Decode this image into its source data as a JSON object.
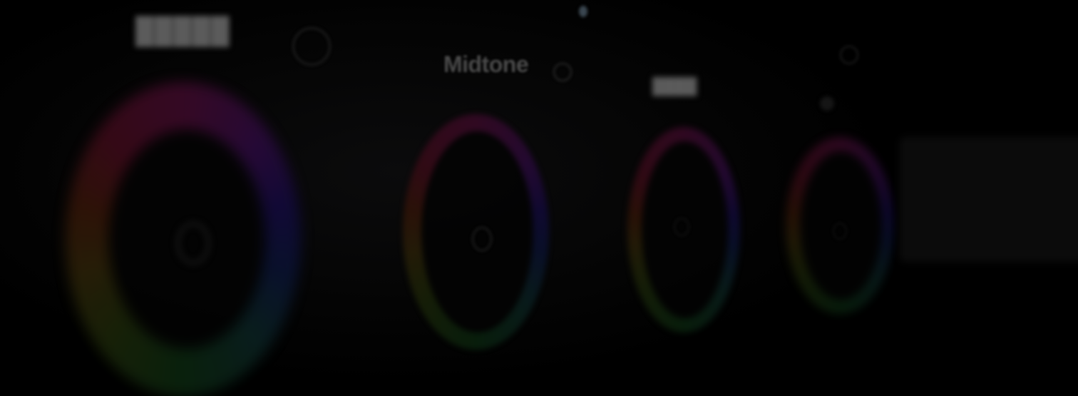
{
  "midtone_panel": {
    "title": "Midtone"
  },
  "wheel_count": 4,
  "colors": {
    "background": "#000000",
    "title_text": "#4a4a4a"
  },
  "icons": {
    "reset": "reset-icon",
    "wheel_handle": "wheel-handle-icon"
  }
}
